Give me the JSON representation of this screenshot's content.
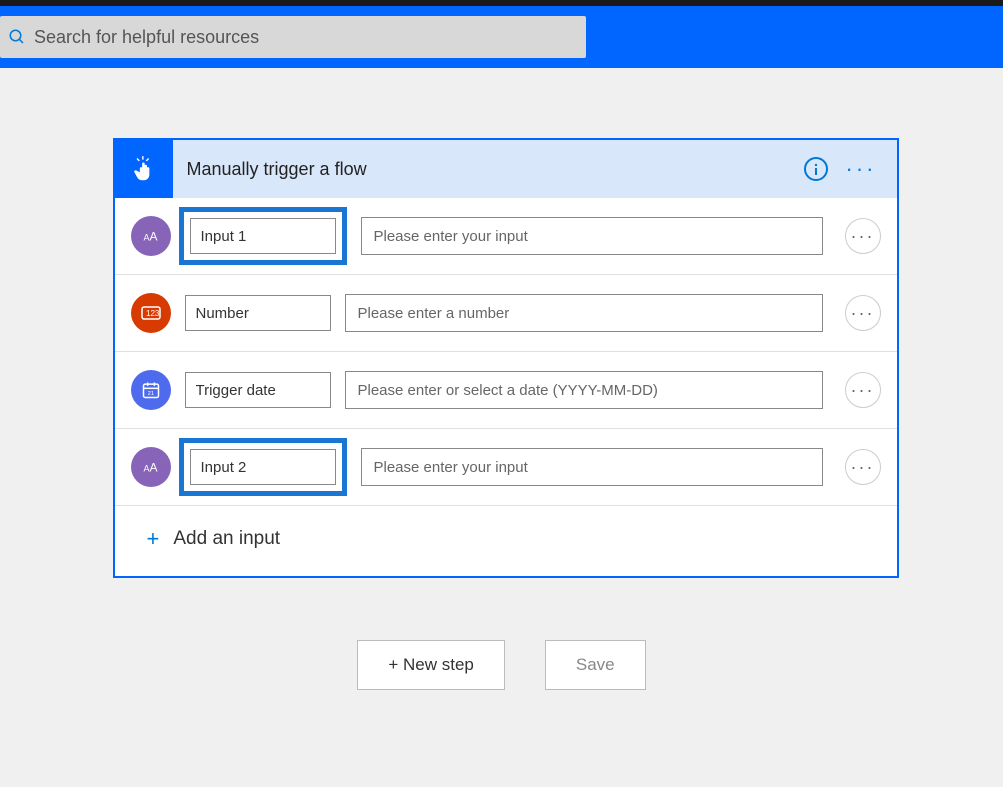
{
  "search": {
    "placeholder": "Search for helpful resources"
  },
  "card": {
    "title": "Manually trigger a flow"
  },
  "inputs": [
    {
      "name": "Input 1",
      "placeholder": "Please enter your input",
      "type": "text",
      "highlighted": true,
      "hasCursor": true
    },
    {
      "name": "Number",
      "placeholder": "Please enter a number",
      "type": "number",
      "highlighted": false
    },
    {
      "name": "Trigger date",
      "placeholder": "Please enter or select a date (YYYY-MM-DD)",
      "type": "date",
      "highlighted": false
    },
    {
      "name": "Input 2",
      "placeholder": "Please enter your input",
      "type": "text",
      "highlighted": true
    }
  ],
  "addInput": "Add an input",
  "actions": {
    "newStep": "+ New step",
    "save": "Save"
  }
}
